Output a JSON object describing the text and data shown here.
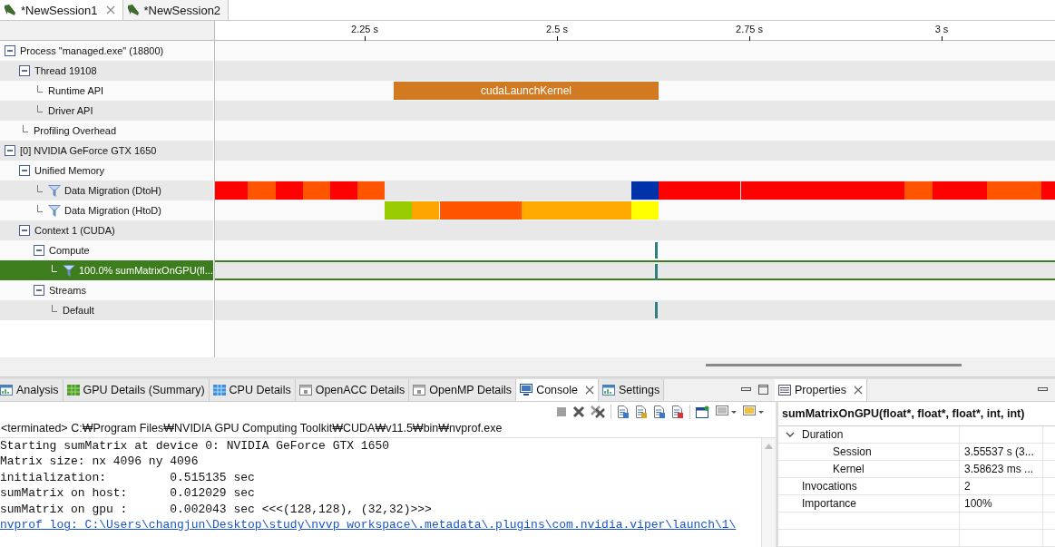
{
  "session_tabs": [
    {
      "label": "*NewSession1",
      "selected": true
    },
    {
      "label": "*NewSession2",
      "selected": false
    }
  ],
  "ruler": {
    "ticks": [
      "2.25 s",
      "2.5 s",
      "2.75 s",
      "3 s"
    ]
  },
  "tree": [
    {
      "label": "Process \"managed.exe\" (18800)",
      "expanded": true,
      "filtered": false,
      "selected": false,
      "children": [
        {
          "label": "Thread 19108",
          "expanded": true,
          "filtered": false,
          "selected": false,
          "children": [
            {
              "label": "Runtime API",
              "filtered": false,
              "selected": false
            },
            {
              "label": "Driver API",
              "filtered": false,
              "selected": false
            }
          ]
        },
        {
          "label": "Profiling Overhead",
          "filtered": false,
          "selected": false
        }
      ]
    },
    {
      "label": "[0] NVIDIA GeForce GTX 1650",
      "expanded": true,
      "filtered": false,
      "selected": false,
      "children": [
        {
          "label": "Unified Memory",
          "expanded": true,
          "filtered": false,
          "selected": false,
          "children": [
            {
              "label": "Data Migration (DtoH)",
              "filtered": true,
              "selected": false
            },
            {
              "label": "Data Migration (HtoD)",
              "filtered": true,
              "selected": false
            }
          ]
        },
        {
          "label": "Context 1 (CUDA)",
          "expanded": true,
          "filtered": false,
          "selected": false,
          "children": [
            {
              "label": "Compute",
              "expanded": true,
              "filtered": false,
              "selected": false,
              "children": [
                {
                  "label": "100.0% sumMatrixOnGPU(fl...",
                  "filtered": true,
                  "selected": true
                }
              ]
            },
            {
              "label": "Streams",
              "expanded": true,
              "filtered": false,
              "selected": false,
              "children": [
                {
                  "label": "Default",
                  "filtered": false,
                  "selected": false
                }
              ]
            }
          ]
        }
      ]
    }
  ],
  "timeline": {
    "api_bar": {
      "label": "cudaLaunchKernel"
    }
  },
  "bottom_tabs": [
    {
      "label": "Analysis",
      "selected": false
    },
    {
      "label": "GPU Details (Summary)",
      "selected": false
    },
    {
      "label": "CPU Details",
      "selected": false
    },
    {
      "label": "OpenACC Details",
      "selected": false
    },
    {
      "label": "OpenMP Details",
      "selected": false
    },
    {
      "label": "Console",
      "selected": true
    },
    {
      "label": "Settings",
      "selected": false
    }
  ],
  "console": {
    "status": "<terminated> C:₩Program Files₩NVIDIA GPU Computing Toolkit₩CUDA₩v11.5₩bin₩nvprof.exe",
    "lines": [
      "Starting sumMatrix at device 0: NVIDIA GeForce GTX 1650",
      "Matrix size: nx 4096 ny 4096",
      "initialization:         0.515135 sec",
      "sumMatrix on host:      0.012029 sec",
      "sumMatrix on gpu :      0.002043 sec <<<(128,128), (32,32)>>>"
    ],
    "link": "nvprof log: C:\\Users\\changjun\\Desktop\\study\\nvvp_workspace\\.metadata\\.plugins\\com.nvidia.viper\\launch\\1\\"
  },
  "properties": {
    "tab": "Properties",
    "title": "sumMatrixOnGPU(float*, float*, float*, int, int)",
    "rows": [
      {
        "label": "Duration",
        "expanded": true,
        "children": [
          {
            "label": "Session",
            "value": "3.55537 s (3..."
          },
          {
            "label": "Kernel",
            "value": "3.58623 ms ..."
          }
        ]
      },
      {
        "label": "Invocations",
        "value": "2"
      },
      {
        "label": "Importance",
        "value": "100%"
      }
    ]
  }
}
